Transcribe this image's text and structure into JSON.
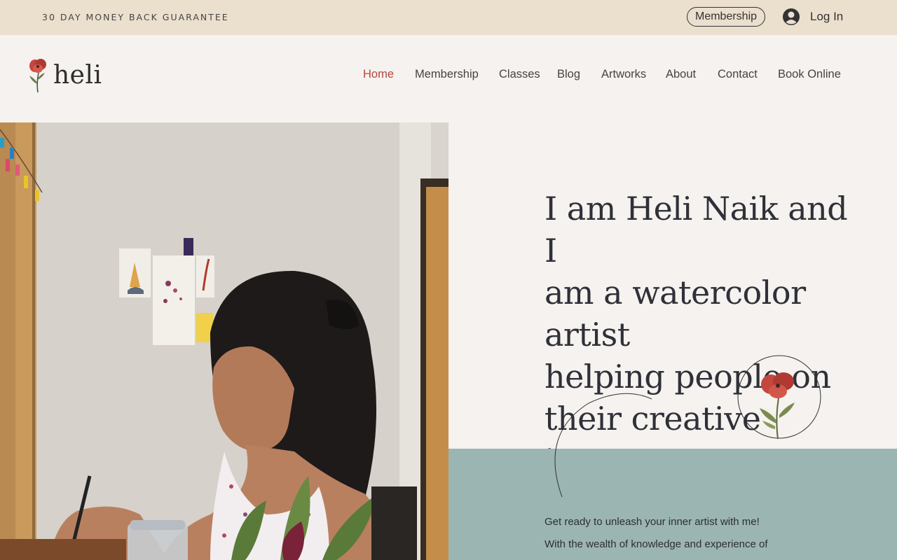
{
  "topbar": {
    "promo": "30 DAY MONEY BACK GUARANTEE",
    "membership_button": "Membership",
    "login_label": "Log In",
    "login_icon": "user-avatar-icon"
  },
  "header": {
    "logo_text": "heli",
    "logo_icon": "poppy-flower-icon",
    "nav": [
      {
        "label": "Home",
        "active": true
      },
      {
        "label": "Membership",
        "active": false
      },
      {
        "label": "Classes",
        "active": false
      },
      {
        "label": "Blog",
        "active": false
      },
      {
        "label": "Artworks",
        "active": false
      },
      {
        "label": "About",
        "active": false
      },
      {
        "label": "Contact",
        "active": false
      },
      {
        "label": "Book Online",
        "active": false
      }
    ]
  },
  "hero": {
    "title_lines": [
      "I am Heli Naik and I",
      "am a watercolor artist",
      "helping people on",
      "their creative journey"
    ],
    "intro_line_1": "Get ready to unleash your inner artist with me!",
    "intro_line_2": "With the wealth of knowledge and experience of"
  },
  "colors": {
    "topbar_bg": "#ebdfce",
    "page_bg": "#f5f2ef",
    "accent_active": "#b8473c",
    "sage_band": "#9bb5b2",
    "text_dark": "#2f3038"
  }
}
